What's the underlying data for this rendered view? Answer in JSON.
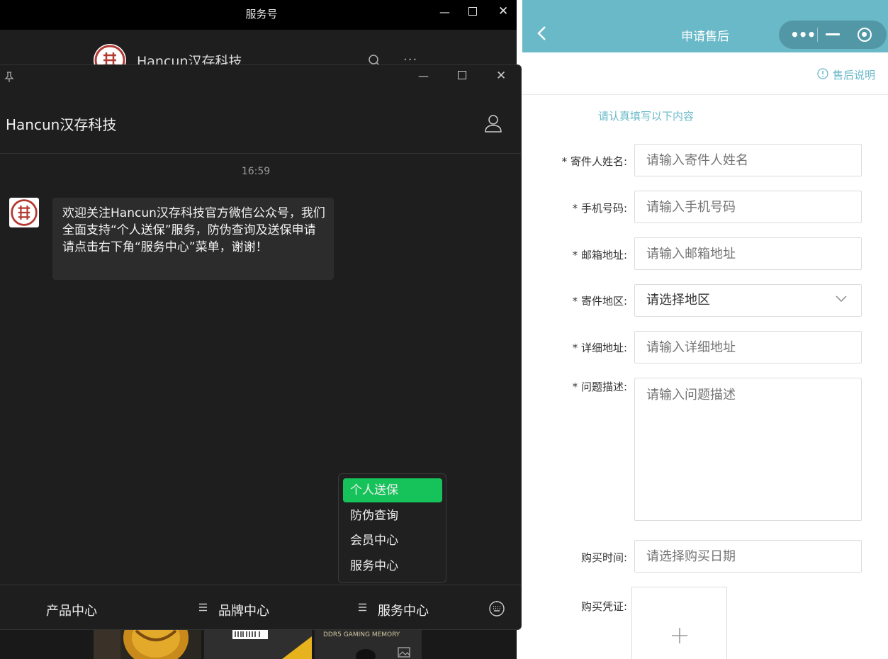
{
  "background_window": {
    "title": "服务号",
    "account_name": "Hancun汉存科技",
    "more": "···",
    "image_caption": "DDR5 GAMING MEMORY"
  },
  "chat": {
    "title": "Hancun汉存科技",
    "time": "16:59",
    "message": "欢迎关注Hancun汉存科技官方微信公众号，我们全面支持“个人送保”服务，防伪查询及送保申请请点击右下角“服务中心”菜单，谢谢！",
    "popup_items": [
      "个人送保",
      "防伪查询",
      "会员中心",
      "服务中心"
    ],
    "menu_tabs": [
      "产品中心",
      "品牌中心",
      "服务中心"
    ]
  },
  "miniprogram": {
    "title": "申请售后",
    "capsule_more": "•••",
    "note": "售后说明",
    "hint": "请认真填写以下内容",
    "fields": [
      {
        "label": "* 寄件人姓名:",
        "placeholder": "请输入寄件人姓名"
      },
      {
        "label": "* 手机号码:",
        "placeholder": "请输入手机号码"
      },
      {
        "label": "* 邮箱地址:",
        "placeholder": "请输入邮箱地址"
      },
      {
        "label": "* 寄件地区:",
        "value": "请选择地区"
      },
      {
        "label": "* 详细地址:",
        "placeholder": "请输入详细地址"
      },
      {
        "label": "* 问题描述:",
        "placeholder": "请输入问题描述"
      },
      {
        "label": "购买时间:",
        "placeholder": "请选择购买日期"
      },
      {
        "label": "购买凭证:"
      }
    ]
  },
  "colors": {
    "accent_teal": "#69b9c9",
    "wechat_green": "#16c25a",
    "chat_bg": "#1e1e1e"
  }
}
